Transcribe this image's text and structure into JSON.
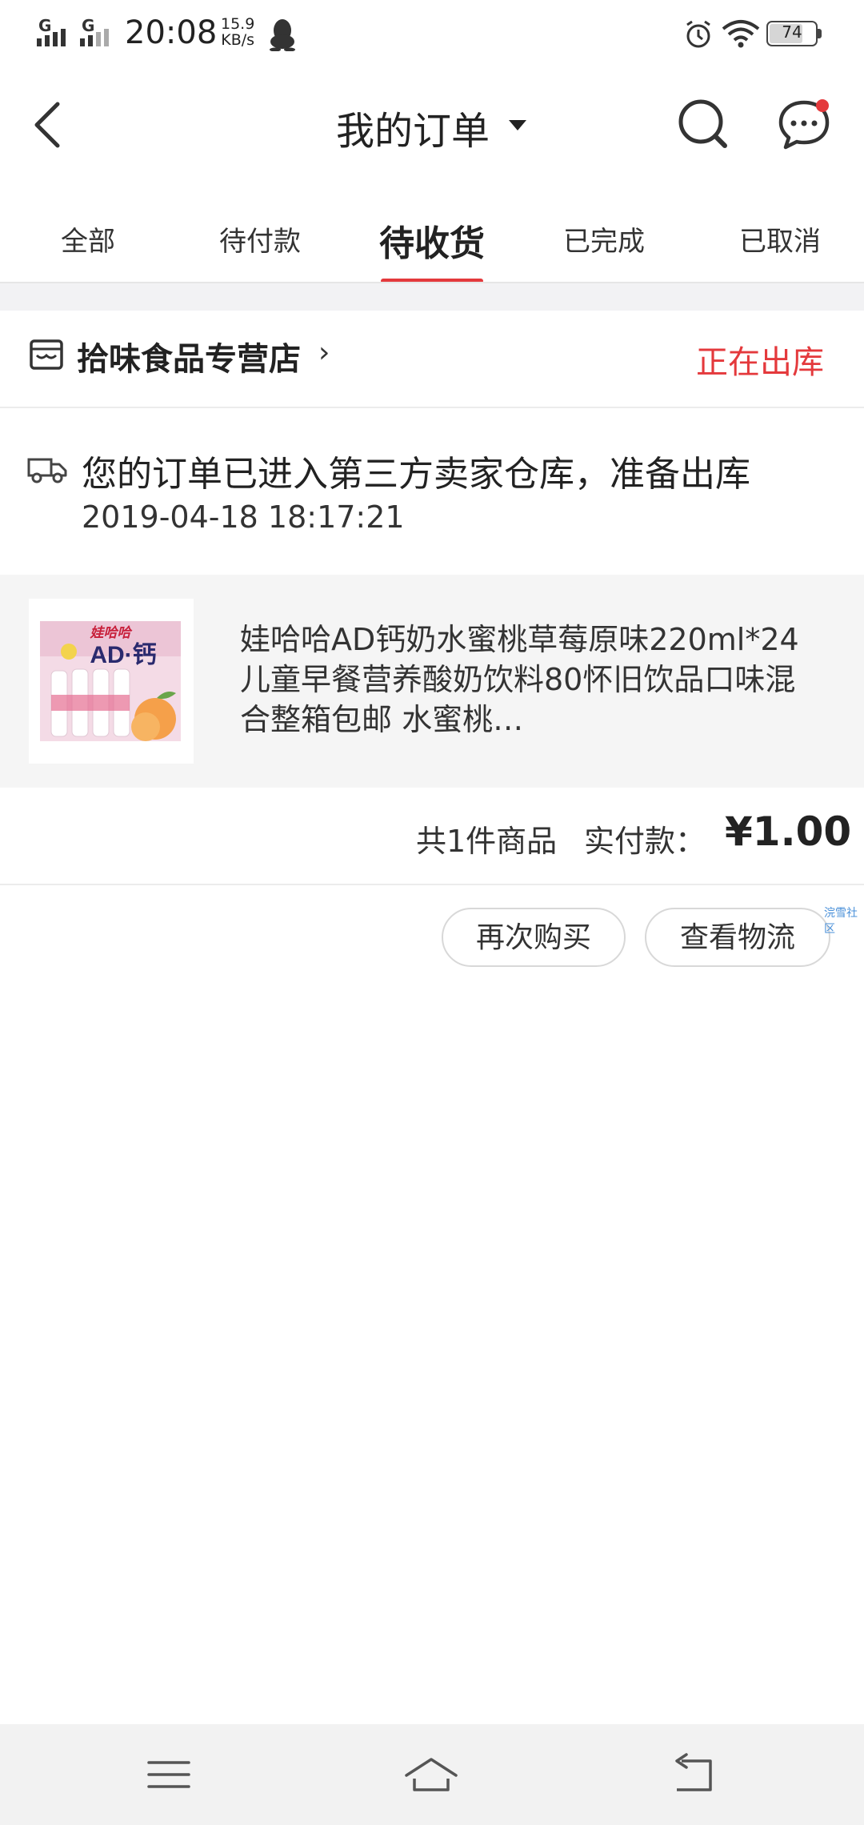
{
  "status_bar": {
    "network1": "G",
    "network2": "G",
    "time": "20:08",
    "speed_value": "15.9",
    "speed_unit": "KB/s",
    "battery": "74",
    "battery_fraction": 0.74
  },
  "nav": {
    "title": "我的订单"
  },
  "tabs": [
    {
      "label": "全部"
    },
    {
      "label": "待付款"
    },
    {
      "label": "待收货"
    },
    {
      "label": "已完成"
    },
    {
      "label": "已取消"
    }
  ],
  "active_tab_index": 2,
  "colors": {
    "accent": "#e4393c",
    "background": "#f2f2f4"
  },
  "order": {
    "store_name": "拾味食品专营店",
    "status": "正在出库",
    "logistics_message": "您的订单已进入第三方卖家仓库，准备出库",
    "logistics_time": "2019-04-18 18:17:21",
    "product_title": "娃哈哈AD钙奶水蜜桃草莓原味220ml*24儿童早餐营养酸奶饮料80怀旧饮品口味混合整箱包邮 水蜜桃…",
    "thumb_brand": "娃哈哈",
    "thumb_product": "AD·钙",
    "item_count": "共1件商品",
    "paid_label": "实付款：",
    "price": "¥1.00"
  },
  "actions": {
    "buy_again": "再次购买",
    "view_logistics": "查看物流"
  },
  "watermark": "浣雪社区"
}
